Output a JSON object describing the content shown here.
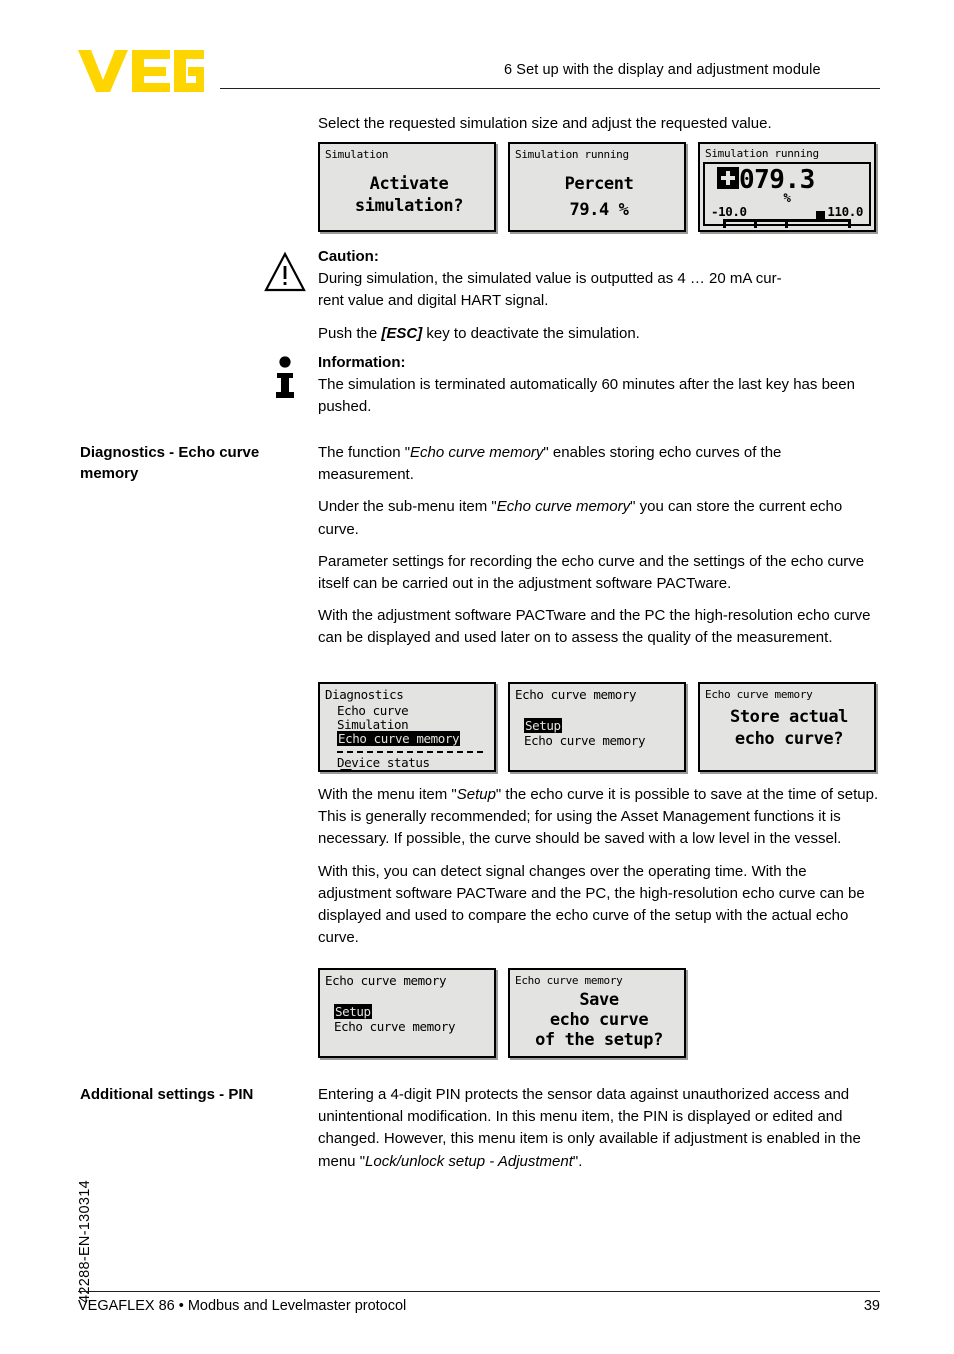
{
  "header": {
    "logo_text": "VEGA",
    "logo_color": "#FFD500",
    "section_title": "6 Set up with the display and adjustment module"
  },
  "footer": {
    "left": "VEGAFLEX 86 • Modbus and Levelmaster protocol",
    "page_number": "39",
    "doc_code": "42288-EN-130314"
  },
  "intro": {
    "line": "Select the requested simulation size and adjust the requested value."
  },
  "displays_row1": [
    {
      "name": "simulation-activate",
      "title": "Simulation",
      "line1": "Activate",
      "line2": "simulation?"
    },
    {
      "name": "simulation-percent",
      "title": "Simulation running",
      "line1": "Percent",
      "line2": "79.4 %"
    },
    {
      "name": "simulation-bargraph",
      "title": "Simulation running",
      "value": "079.3",
      "sign": "+",
      "unit": "%",
      "scale_min": "-10.0",
      "scale_max": "110.0",
      "marker_percent": 79.3
    }
  ],
  "caution": {
    "icon": "warning-triangle-icon",
    "title": "Caution:",
    "para1_a": "During simulation, the simulated value is outputted as 4 … 20 mA cur-",
    "para1_b": "rent value and digital HART signal.",
    "para2_before": "Push the ",
    "para2_key": "[ESC]",
    "para2_after": " key to deactivate the simulation."
  },
  "information": {
    "icon": "info-icon",
    "title": "Information:",
    "para": "The simulation is terminated automatically 60 minutes after the last key has been pushed."
  },
  "section_echo": {
    "margin_heading": "Diagnostics - Echo curve memory",
    "p1_a": "The function \"",
    "p1_em": "Echo curve memory",
    "p1_b": "\" enables storing echo curves of the measurement.",
    "p2_a": "Under the sub-menu item \"",
    "p2_em": "Echo curve memory",
    "p2_b": "\" you can store the current echo curve.",
    "p3": "Parameter settings for recording the echo curve and the settings of the echo curve itself can be carried out in the adjustment software PACTware.",
    "p4": "With the adjustment software PACTware and the PC the high-resolution echo curve can be displayed and used later on to assess the quality of the measurement."
  },
  "displays_row2": [
    {
      "name": "diagnostics-menu",
      "title": "Diagnostics",
      "items": [
        "Echo curve",
        "Simulation",
        "Echo curve memory"
      ],
      "selected_index": 2,
      "after_separator": "Device status"
    },
    {
      "name": "echo-curve-memory-menu",
      "title": "Echo curve memory",
      "items": [
        "Setup",
        "Echo curve memory"
      ],
      "selected_index": 0
    },
    {
      "name": "store-actual-echo-curve",
      "title": "Echo curve memory",
      "line1": "Store actual",
      "line2": "echo curve?"
    }
  ],
  "section_setup": {
    "p1_a": "With the menu item \"",
    "p1_em": "Setup",
    "p1_b": "\" the echo curve it is possible to save at the time of setup. This is generally recommended; for using the Asset Management functions it is necessary. If possible, the curve should be saved with a low level in the vessel.",
    "p2": "With this, you can detect signal changes over the operating time. With the adjustment software PACTware and the PC, the high-resolution echo curve can be displayed and used to compare the echo curve of the setup with the actual echo curve."
  },
  "displays_row3": [
    {
      "name": "echo-curve-memory-menu-2",
      "title": "Echo curve memory",
      "items": [
        "Setup",
        "Echo curve memory"
      ],
      "selected_index": 0
    },
    {
      "name": "save-echo-curve-of-setup",
      "title": "Echo curve memory",
      "line1": "Save",
      "line2": "echo curve",
      "line3": "of the setup?"
    }
  ],
  "section_pin": {
    "margin_heading": "Additional settings - PIN",
    "p1_a": "Entering a 4-digit PIN protects the sensor data against unauthorized access and unintentional modification. In this menu item, the PIN is displayed or edited and changed. However, this menu item is only available if adjustment is enabled in the menu \"",
    "p1_em": "Lock/unlock setup - Adjustment",
    "p1_b": "\"."
  }
}
